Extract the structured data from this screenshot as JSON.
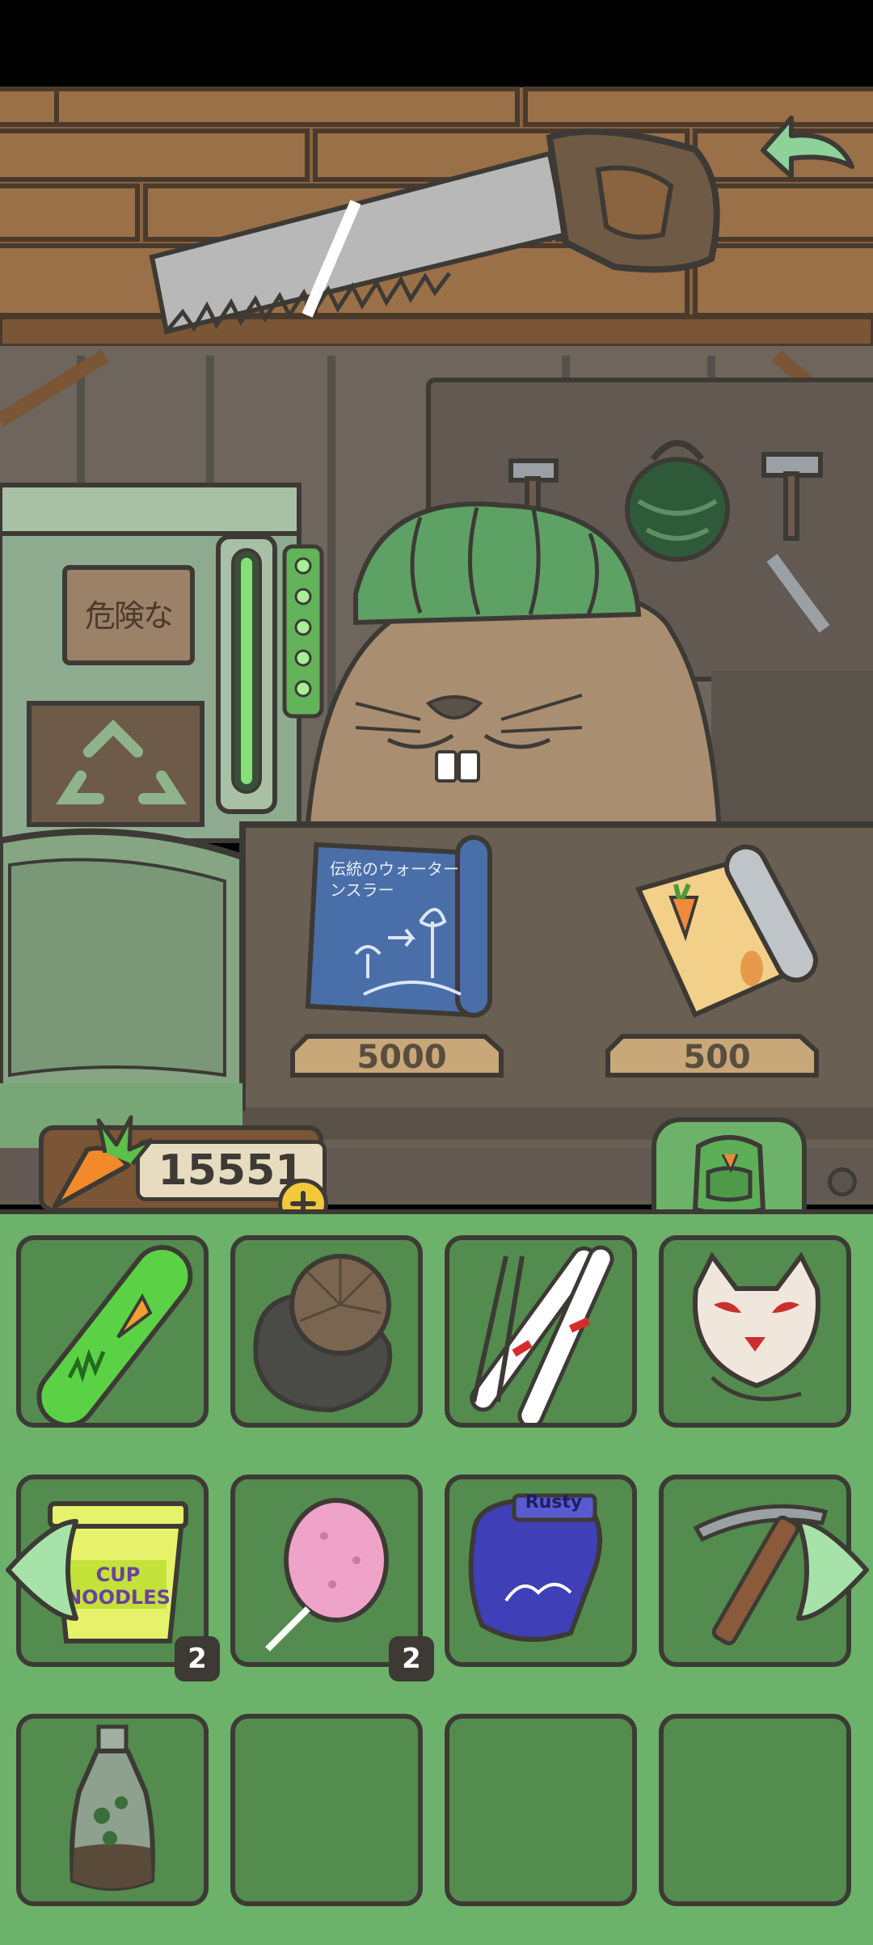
{
  "colors": {
    "wood": "#8a6340",
    "wall": "#6e665c",
    "counter": "#6a5f53",
    "inventory_bg": "#6db26a",
    "slot_bg": "#538c4e",
    "outline": "#3d3a35",
    "accent_green": "#9fdca3"
  },
  "shop": {
    "sign_text": "危険な",
    "blueprint_text": "伝統のウォーターンスラー",
    "items": [
      {
        "name": "blueprint",
        "price": "5000"
      },
      {
        "name": "carrot-recipe-scroll",
        "price": "500"
      }
    ]
  },
  "currency": {
    "icon": "carrot-icon",
    "amount": "15551"
  },
  "inventory": {
    "slots": [
      {
        "item": "carrot-snowboard",
        "count": ""
      },
      {
        "item": "fur-hat",
        "count": ""
      },
      {
        "item": "skis-and-poles",
        "count": ""
      },
      {
        "item": "fox-mask",
        "count": ""
      },
      {
        "item": "cup-noodles",
        "label": "CUP NOODLES",
        "count": "2"
      },
      {
        "item": "cotton-candy",
        "count": "2"
      },
      {
        "item": "boxing-gloves",
        "label": "Rusty",
        "count": ""
      },
      {
        "item": "ice-axe",
        "count": ""
      },
      {
        "item": "bottle-terrarium",
        "count": ""
      },
      {
        "item": "",
        "count": ""
      },
      {
        "item": "",
        "count": ""
      },
      {
        "item": "",
        "count": ""
      }
    ]
  }
}
